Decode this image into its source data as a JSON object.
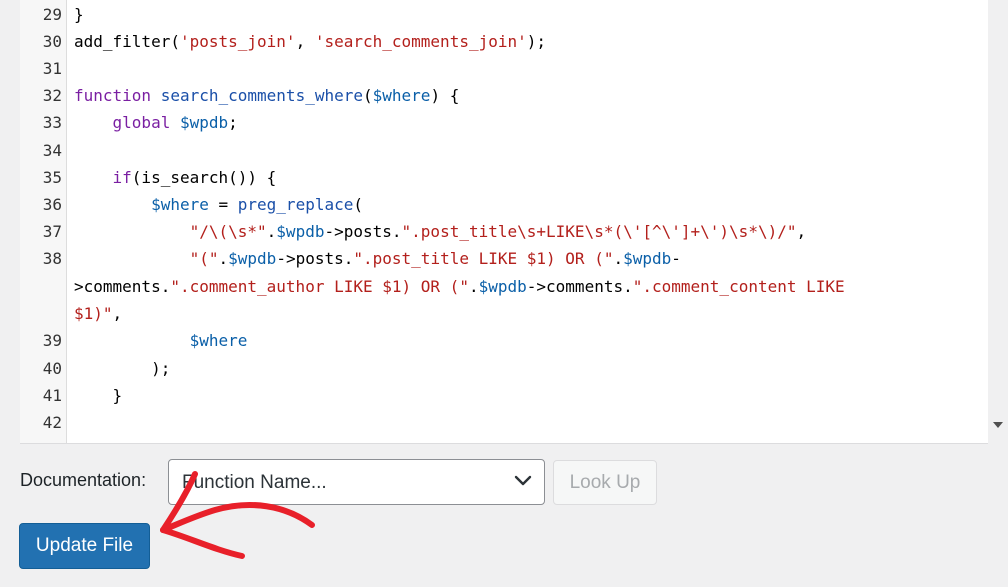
{
  "editor": {
    "lines": [
      {
        "n": "29",
        "tokens": [
          {
            "t": "plain",
            "v": "}"
          }
        ]
      },
      {
        "n": "30",
        "tokens": [
          {
            "t": "plain",
            "v": "add_filter("
          },
          {
            "t": "string",
            "v": "'posts_join'"
          },
          {
            "t": "plain",
            "v": ", "
          },
          {
            "t": "string",
            "v": "'search_comments_join'"
          },
          {
            "t": "plain",
            "v": ");"
          }
        ]
      },
      {
        "n": "31",
        "tokens": []
      },
      {
        "n": "32",
        "tokens": [
          {
            "t": "keyword",
            "v": "function"
          },
          {
            "t": "plain",
            "v": " "
          },
          {
            "t": "def",
            "v": "search_comments_where"
          },
          {
            "t": "plain",
            "v": "("
          },
          {
            "t": "variable",
            "v": "$where"
          },
          {
            "t": "plain",
            "v": ") {"
          }
        ]
      },
      {
        "n": "33",
        "tokens": [
          {
            "t": "plain",
            "v": "    "
          },
          {
            "t": "keyword",
            "v": "global"
          },
          {
            "t": "plain",
            "v": " "
          },
          {
            "t": "variable",
            "v": "$wpdb"
          },
          {
            "t": "plain",
            "v": ";"
          }
        ]
      },
      {
        "n": "34",
        "tokens": []
      },
      {
        "n": "35",
        "tokens": [
          {
            "t": "plain",
            "v": "    "
          },
          {
            "t": "keyword",
            "v": "if"
          },
          {
            "t": "plain",
            "v": "(is_search()) {"
          }
        ]
      },
      {
        "n": "36",
        "tokens": [
          {
            "t": "plain",
            "v": "        "
          },
          {
            "t": "variable",
            "v": "$where"
          },
          {
            "t": "plain",
            "v": " = "
          },
          {
            "t": "def",
            "v": "preg_replace"
          },
          {
            "t": "plain",
            "v": "("
          }
        ]
      },
      {
        "n": "37",
        "tokens": [
          {
            "t": "plain",
            "v": "            "
          },
          {
            "t": "string",
            "v": "\"/\\(\\s*\""
          },
          {
            "t": "plain",
            "v": "."
          },
          {
            "t": "variable",
            "v": "$wpdb"
          },
          {
            "t": "plain",
            "v": "->posts."
          },
          {
            "t": "string",
            "v": "\".post_title\\s+LIKE\\s*(\\'[^\\']+\\')\\s*\\)/\""
          },
          {
            "t": "plain",
            "v": ","
          }
        ]
      },
      {
        "n": "38",
        "tokens": [
          {
            "t": "plain",
            "v": "            "
          },
          {
            "t": "string",
            "v": "\"(\""
          },
          {
            "t": "plain",
            "v": "."
          },
          {
            "t": "variable",
            "v": "$wpdb"
          },
          {
            "t": "plain",
            "v": "->posts."
          },
          {
            "t": "string",
            "v": "\".post_title LIKE $1) OR (\""
          },
          {
            "t": "plain",
            "v": "."
          },
          {
            "t": "variable",
            "v": "$wpdb"
          },
          {
            "t": "plain",
            "v": "-"
          }
        ]
      },
      {
        "n": "",
        "tokens": [
          {
            "t": "plain",
            "v": ">comments."
          },
          {
            "t": "string",
            "v": "\".comment_author LIKE $1) OR (\""
          },
          {
            "t": "plain",
            "v": "."
          },
          {
            "t": "variable",
            "v": "$wpdb"
          },
          {
            "t": "plain",
            "v": "->comments."
          },
          {
            "t": "string",
            "v": "\".comment_content LIKE"
          }
        ]
      },
      {
        "n": "",
        "tokens": [
          {
            "t": "string",
            "v": "$1)\""
          },
          {
            "t": "plain",
            "v": ","
          }
        ]
      },
      {
        "n": "39",
        "tokens": [
          {
            "t": "plain",
            "v": "            "
          },
          {
            "t": "variable",
            "v": "$where"
          }
        ]
      },
      {
        "n": "40",
        "tokens": [
          {
            "t": "plain",
            "v": "        );"
          }
        ]
      },
      {
        "n": "41",
        "tokens": [
          {
            "t": "plain",
            "v": "    }"
          }
        ]
      },
      {
        "n": "42",
        "tokens": []
      }
    ]
  },
  "documentation": {
    "label": "Documentation:",
    "select_value": "Function Name...",
    "lookup_label": "Look Up"
  },
  "update_label": "Update File",
  "colors": {
    "keyword": "#7a1fa2",
    "def": "#1a4fa8",
    "variable": "#0a5fa8",
    "string": "#b3201c",
    "primary_button": "#2271b1",
    "annotation": "#e8202a"
  },
  "icons": {
    "select": "chevron-down-icon",
    "scroll": "scroll-down-arrow-icon",
    "annotation": "hand-drawn-arrow"
  }
}
